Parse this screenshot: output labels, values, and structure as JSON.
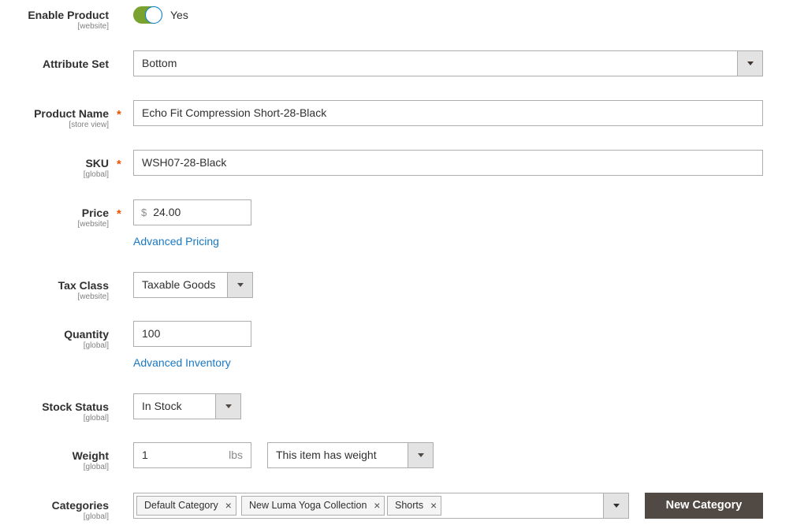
{
  "fields": {
    "enable_product": {
      "label": "Enable Product",
      "scope": "[website]",
      "value_text": "Yes",
      "enabled": true
    },
    "attribute_set": {
      "label": "Attribute Set",
      "value": "Bottom"
    },
    "product_name": {
      "label": "Product Name",
      "scope": "[store view]",
      "required": "*",
      "value": "Echo Fit Compression Short-28-Black"
    },
    "sku": {
      "label": "SKU",
      "scope": "[global]",
      "required": "*",
      "value": "WSH07-28-Black"
    },
    "price": {
      "label": "Price",
      "scope": "[website]",
      "required": "*",
      "currency_symbol": "$",
      "value": "24.00",
      "link": "Advanced Pricing"
    },
    "tax_class": {
      "label": "Tax Class",
      "scope": "[website]",
      "value": "Taxable Goods"
    },
    "quantity": {
      "label": "Quantity",
      "scope": "[global]",
      "value": "100",
      "link": "Advanced Inventory"
    },
    "stock_status": {
      "label": "Stock Status",
      "scope": "[global]",
      "value": "In Stock"
    },
    "weight": {
      "label": "Weight",
      "scope": "[global]",
      "value": "1",
      "unit": "lbs",
      "weight_option": "This item has weight"
    },
    "categories": {
      "label": "Categories",
      "scope": "[global]",
      "tags": [
        {
          "label": "Default Category",
          "remove_icon": "×"
        },
        {
          "label": "New Luma Yoga Collection",
          "remove_icon": "×"
        },
        {
          "label": "Shorts",
          "remove_icon": "×"
        }
      ],
      "new_category_button": "New Category"
    }
  },
  "colors": {
    "toggle_on": "#79a22e",
    "required_star": "#eb5202",
    "link": "#1979c3",
    "primary_button": "#514943"
  }
}
